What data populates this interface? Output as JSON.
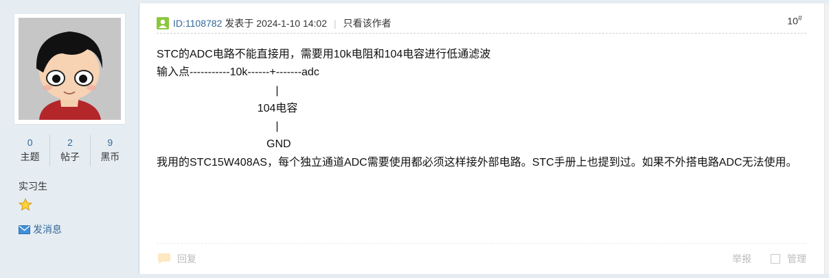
{
  "colors": {
    "sidebar_bg": "#e5edf2",
    "link": "#336699",
    "online_icon": "#8cc63f"
  },
  "user": {
    "avatar_icon": "cartoon-boy-avatar",
    "stats": [
      {
        "value": "0",
        "label": "主题"
      },
      {
        "value": "2",
        "label": "帖子"
      },
      {
        "value": "9",
        "label": "黑币"
      }
    ],
    "rank": "实习生",
    "rank_icon": "star-icon",
    "send_message": "发消息"
  },
  "post": {
    "author": "ID:1108782",
    "posted_at": "发表于 2024-1-10 14:02",
    "separator": "|",
    "only_author": "只看该作者",
    "floor_number": "10",
    "floor_mark": "#",
    "lines": [
      "STC的ADC电路不能直接用，需要用10k电阻和104电容进行低通滤波",
      "输入点-----------10k------+-------adc",
      "                                       |",
      "                                 104电容",
      "                                       |",
      "                                    GND",
      "我用的STC15W408AS，每个独立通道ADC需要使用都必须这样接外部电路。STC手册上也提到过。如果不外搭电路ADC无法使用。"
    ]
  },
  "footer": {
    "reply": "回复",
    "report": "举报",
    "manage": "管理"
  }
}
